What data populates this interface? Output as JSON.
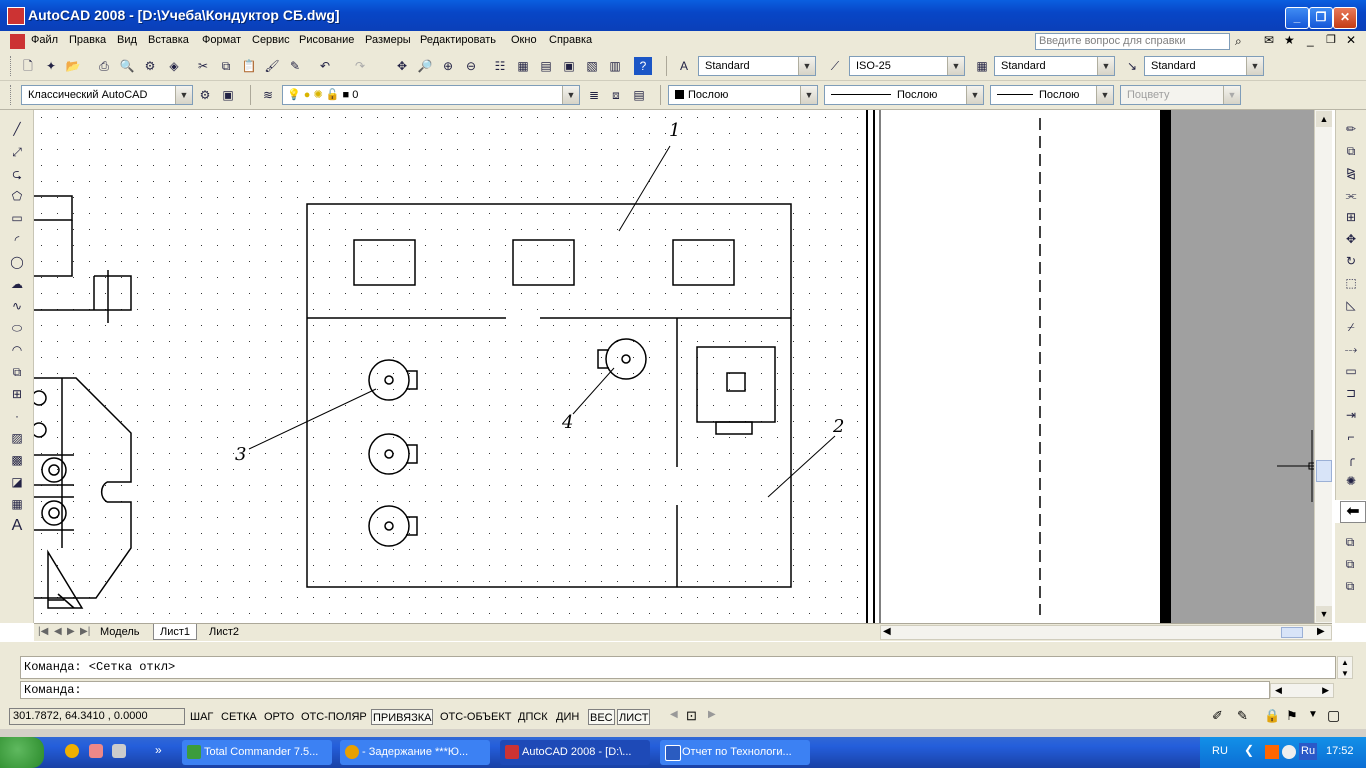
{
  "window": {
    "title": "AutoCAD 2008 - [D:\\Учеба\\Кондуктор СБ.dwg]"
  },
  "menu": {
    "items": [
      "Файл",
      "Правка",
      "Вид",
      "Вставка",
      "Формат",
      "Сервис",
      "Рисование",
      "Размеры",
      "Редактировать",
      "Окно",
      "Справка"
    ],
    "help_placeholder": "Введите вопрос для справки"
  },
  "styles": {
    "text_style": "Standard",
    "dim_style": "ISO-25",
    "table_style": "Standard",
    "mleader_style": "Standard"
  },
  "workspace": {
    "name": "Классический AutoCAD"
  },
  "layer": {
    "current": "0"
  },
  "properties": {
    "color": "Послою",
    "linetype": "Послою",
    "lineweight": "Послою",
    "plotstyle": "Поцвету"
  },
  "drawing": {
    "callouts": [
      "1",
      "2",
      "3",
      "4"
    ]
  },
  "tabs": [
    "Модель",
    "Лист1",
    "Лист2"
  ],
  "command": {
    "history": "Команда:  <Сетка откл>",
    "prompt": "Команда:"
  },
  "status": {
    "coords": "301.7872, 64.3410 , 0.0000",
    "toggles": [
      {
        "label": "ШАГ",
        "on": false
      },
      {
        "label": "СЕТКА",
        "on": false
      },
      {
        "label": "ОРТО",
        "on": false
      },
      {
        "label": "ОТС-ПОЛЯР",
        "on": false
      },
      {
        "label": "ПРИВЯЗКА",
        "on": true
      },
      {
        "label": "ОТС-ОБЪЕКТ",
        "on": false
      },
      {
        "label": "ДПСК",
        "on": false
      },
      {
        "label": "ДИН",
        "on": false
      },
      {
        "label": "ВЕС",
        "on": true
      },
      {
        "label": "ЛИСТ",
        "on": true
      }
    ]
  },
  "taskbar": {
    "tasks": [
      "Total Commander 7.5...",
      "- Задержание ***Ю...",
      "AutoCAD 2008 - [D:\\...",
      "Отчет по Технологи..."
    ],
    "lang": "RU",
    "lang2": "Ru",
    "clock": "17:52"
  },
  "colors": {
    "title": "#0a4fd1",
    "chrome": "#ece9d8",
    "taskbar": "#245edb",
    "paper_gray": "#a0a0a0"
  }
}
